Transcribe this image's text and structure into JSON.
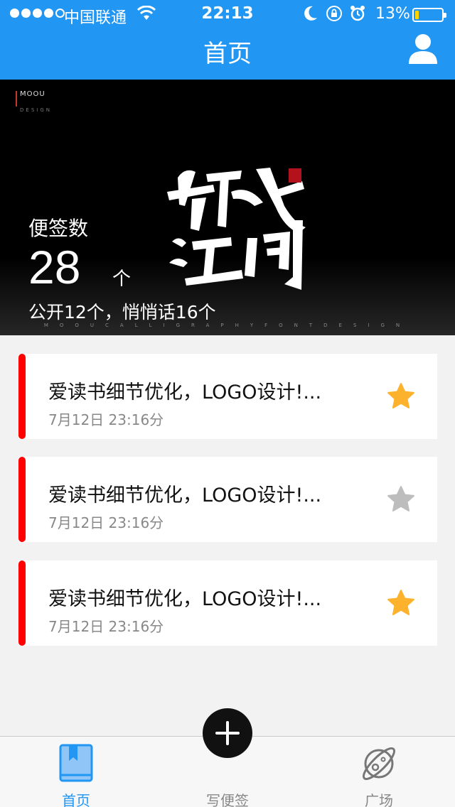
{
  "status_bar": {
    "carrier": "中国联通",
    "time": "22:13",
    "battery": "13%",
    "battery_level": 0.13,
    "icons": [
      "signal-dots",
      "wifi-icon",
      "moon-icon",
      "rotation-lock-icon",
      "alarm-icon",
      "battery-icon"
    ]
  },
  "header": {
    "title": "首页",
    "profile_icon": "user-icon"
  },
  "banner": {
    "brand": "MOOU",
    "brand_sub": "DESIGN",
    "count_label": "便签数",
    "count": "28",
    "count_unit": "个",
    "detail": "公开12个，悄悄话16个",
    "tagline": "MOOUCALLIGRAPHYFONTDESIGN"
  },
  "notes": [
    {
      "title": "爱读书细节优化，LOGO设计!...",
      "date": "7月12日 23:16分",
      "starred": true
    },
    {
      "title": "爱读书细节优化，LOGO设计!...",
      "date": "7月12日 23:16分",
      "starred": false
    },
    {
      "title": "爱读书细节优化，LOGO设计!...",
      "date": "7月12日 23:16分",
      "starred": true
    }
  ],
  "tabs": [
    {
      "label": "首页",
      "icon": "book-icon",
      "active": true
    },
    {
      "label": "写便签",
      "icon": "plus-icon",
      "active": false
    },
    {
      "label": "广场",
      "icon": "planet-icon",
      "active": false
    }
  ],
  "colors": {
    "primary": "#2196f3",
    "accent_bar": "#ff0000",
    "star_on": "#fdb22d",
    "star_off": "#bdbdbd"
  }
}
